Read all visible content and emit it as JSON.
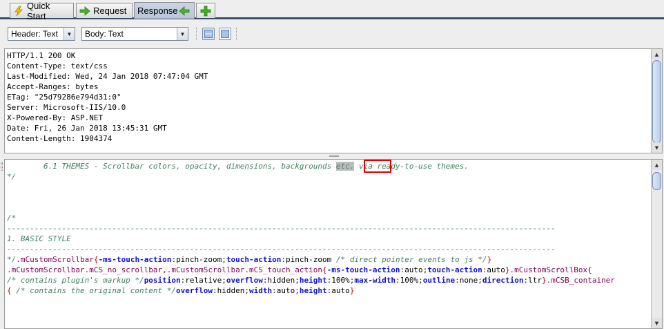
{
  "tabs": [
    {
      "label": "Quick Start",
      "icon": "lightning-icon",
      "active": false
    },
    {
      "label": "Request",
      "icon": "arrow-right-icon",
      "active": false
    },
    {
      "label": "Response",
      "icon": "arrow-left-icon",
      "active": true
    }
  ],
  "add_tab_icon": "plus-icon",
  "toolbar": {
    "header_combo": "Header: Text",
    "body_combo": "Body: Text",
    "layout_buttons": [
      "split-horizontal-icon",
      "split-vertical-icon"
    ]
  },
  "headers_pane": {
    "lines": [
      "HTTP/1.1 200 OK",
      "Content-Type: text/css",
      "Last-Modified: Wed, 24 Jan 2018 07:47:04 GMT",
      "Accept-Ranges: bytes",
      "ETag: \"25d79286e794d31:0\"",
      "Server: Microsoft-IIS/10.0",
      "X-Powered-By: ASP.NET",
      "Date: Fri, 26 Jan 2018 13:45:31 GMT",
      "Content-Length: 1904374"
    ]
  },
  "body_pane": {
    "line1_before": "        6.1 THEMES - Scrollbar colors, opacity, dimensions, backgrounds ",
    "line1_highlight": "etc.",
    "line1_after": " via ready-to-use themes.",
    "line2": "*/",
    "line6": "/*",
    "line7": "------------------------------------------------------------------------------------------------------------------------",
    "line8": "1. BASIC STYLE",
    "line9": "------------------------------------------------------------------------------------------------------------------------",
    "line10": {
      "c1": "*/",
      "s1": ".mCustomScrollbar",
      "b1": "{",
      "p1": "-ms-touch-action",
      "v1": "pinch-zoom",
      "p2": "touch-action",
      "v2": "pinch-zoom",
      "c2": " /* direct pointer events to js */",
      "b2": "}"
    },
    "line11": {
      "s1": ".mCustomScrollbar.mCS_no_scrollbar",
      "s2": ",",
      "s3": ".mCustomScrollbar.mCS_touch_action",
      "b1": "{",
      "p1": "-ms-touch-action",
      "v1": "auto",
      "p2": "touch-action",
      "v2": "auto",
      "b2": "}",
      "s4": ".mCustomScrollBox",
      "b3": "{"
    },
    "line12": {
      "c1": "/* contains plugin's markup */",
      "p1": "position",
      "v1": "relative",
      "p2": "overflow",
      "v2": "hidden",
      "p3": "height",
      "v3": "100%",
      "p4": "max-width",
      "v4": "100%",
      "p5": "outline",
      "v5": "none",
      "p6": "direction",
      "v6": "ltr",
      "b1": "}",
      "s1": ".mCSB_container"
    },
    "line13": {
      "b1": "{",
      "c1": " /* contains the original content */",
      "p1": "overflow",
      "v1": "hidden",
      "p2": "width",
      "v2": "auto",
      "p3": "height",
      "v3": "auto",
      "b2": "}"
    }
  },
  "colors": {
    "comment": "#3f7f5f",
    "selector": "#7f0055",
    "brace": "#b80000",
    "property": "#1010d0",
    "tab_active": "#b9c6d8",
    "highlight_box": "#e00000"
  }
}
